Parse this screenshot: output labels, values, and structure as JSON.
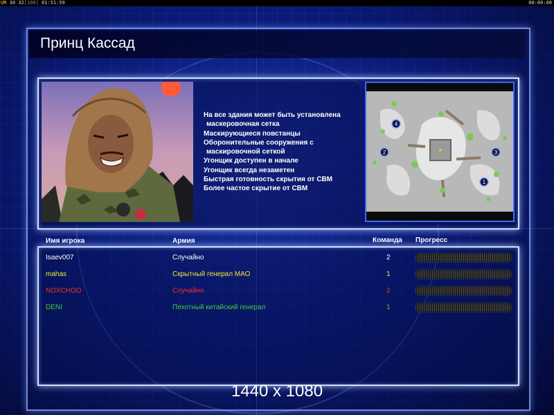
{
  "status_bar": {
    "ur_label": "UR",
    "val1": "30",
    "val2": "32",
    "val3": "[100]",
    "clock": "01:51:59",
    "timer": "00:00:00"
  },
  "general": {
    "name": "Принц Кассад",
    "bonuses": [
      "На все здания может быть установлена",
      " маскеровочная сетка",
      "Маскирующиеся повстанцы",
      "Оборонительные сооружения с",
      " маскировочной сеткой",
      "Угонщик доступен в начале",
      "Угонщик всегда незаметен",
      "Быстрая готовность скрытия от СВМ",
      "Более частое скрытие от СВМ"
    ]
  },
  "minimap": {
    "start_positions": [
      "1",
      "2",
      "3",
      "4"
    ]
  },
  "table": {
    "headers": {
      "name": "Имя игрока",
      "army": "Армия",
      "team": "Команда",
      "progress": "Прогресс"
    },
    "rows": [
      {
        "name": "Isaev007",
        "army": "Случайно",
        "team": "2",
        "color": "#ffffff",
        "progress": 0
      },
      {
        "name": "mahas",
        "army": "Скрытный генерал МАО",
        "team": "1",
        "color": "#f2e832",
        "progress": 0
      },
      {
        "name": "NOXCHOO",
        "army": "Случайно",
        "team": "2",
        "color": "#ff2a1f",
        "progress": 0
      },
      {
        "name": "DENI",
        "army": "Пехотный китайский генерал",
        "team": "1",
        "color": "#3ad23a",
        "progress": 0
      }
    ]
  },
  "resolution_label": "1440 x 1080",
  "colors": {
    "background": "#0a1a7a",
    "panel_border": "#cfe0ff",
    "minimap_border": "#3c6bff"
  }
}
